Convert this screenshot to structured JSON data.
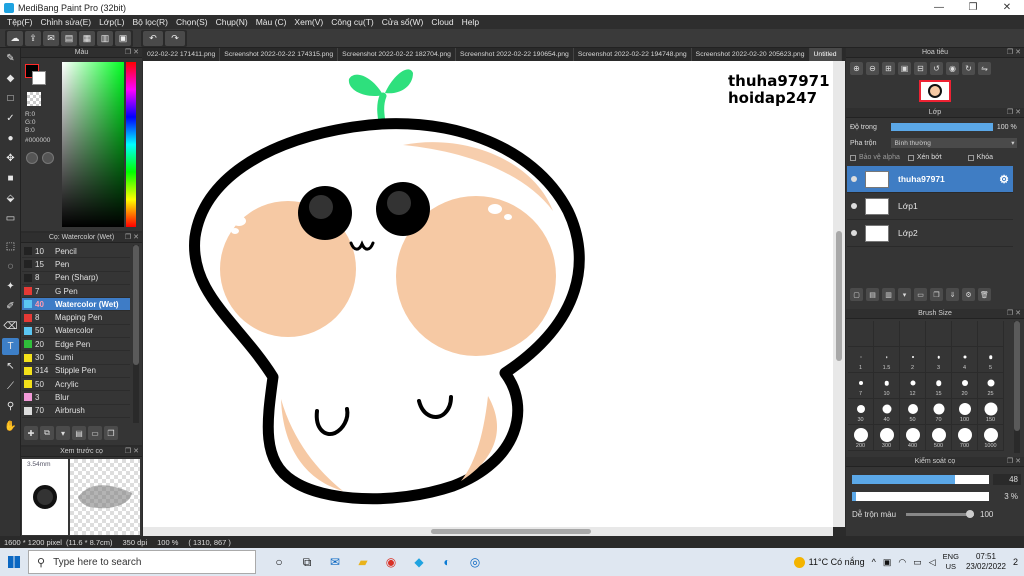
{
  "window": {
    "title": "MediBang Paint Pro (32bit)",
    "min": "—",
    "max": "❐",
    "close": "✕"
  },
  "menu": [
    "Tệp(F)",
    "Chỉnh sửa(E)",
    "Lớp(L)",
    "Bộ lọc(R)",
    "Chọn(S)",
    "Chụp(N)",
    "Màu (C)",
    "Xem(V)",
    "Công cụ(T)",
    "Cửa sổ(W)",
    "Cloud",
    "Help"
  ],
  "color_panel": {
    "title": "Màu",
    "r": "R:0",
    "g": "G:0",
    "b": "B:0",
    "hex": "#000000",
    "fg_color": "#000000",
    "bg_color": "#ffffff"
  },
  "brush_panel": {
    "title": "Cọ: Watercolor (Wet)",
    "brushes": [
      {
        "size": "10",
        "name": "Pencil",
        "color": "#222222"
      },
      {
        "size": "15",
        "name": "Pen",
        "color": "#222222"
      },
      {
        "size": "8",
        "name": "Pen (Sharp)",
        "color": "#222222"
      },
      {
        "size": "7",
        "name": "G Pen",
        "color": "#e53935"
      },
      {
        "size": "40",
        "name": "Watercolor (Wet)",
        "color": "#5bc6f2"
      },
      {
        "size": "8",
        "name": "Mapping Pen",
        "color": "#e53935"
      },
      {
        "size": "50",
        "name": "Watercolor",
        "color": "#5bc6f2"
      },
      {
        "size": "20",
        "name": "Edge Pen",
        "color": "#2fbf3a"
      },
      {
        "size": "30",
        "name": "Sumi",
        "color": "#f4e11a"
      },
      {
        "size": "314",
        "name": "Stipple Pen",
        "color": "#f4e11a"
      },
      {
        "size": "50",
        "name": "Acrylic",
        "color": "#f4e11a"
      },
      {
        "size": "3",
        "name": "Blur",
        "color": "#f29ad8"
      },
      {
        "size": "70",
        "name": "Airbrush",
        "color": "#dddddd"
      }
    ],
    "active_index": 4
  },
  "preview": {
    "title": "Xem trước cọ",
    "size": "3.54mm"
  },
  "doc_tabs": [
    "022-02-22 171411.png",
    "Screenshot 2022-02-22 174315.png",
    "Screenshot 2022-02-22 182704.png",
    "Screenshot 2022-02-22 190654.png",
    "Screenshot 2022-02-22 194748.png",
    "Screenshot 2022-02-20 205623.png",
    "Untitled"
  ],
  "canvas": {
    "watermark_line1": "thuha97971",
    "watermark_line2": "hoidap247"
  },
  "navigator": {
    "title": "Hoa tiêu"
  },
  "layers": {
    "title": "Lớp",
    "opacity_label": "Độ trong",
    "opacity_value": "100 %",
    "opacity_fraction": 1.0,
    "blend_label": "Pha trộn",
    "blend_value": "Bình thường",
    "protect_alpha": "Bảo vệ alpha",
    "clipping": "Xén bớt",
    "lock": "Khóa",
    "items": [
      {
        "name": "thuha97971",
        "active": true
      },
      {
        "name": "Lớp1",
        "active": false
      },
      {
        "name": "Lớp2",
        "active": false
      }
    ]
  },
  "brush_size": {
    "title": "Brush Size",
    "sizes": [
      "",
      "",
      "",
      "",
      "",
      "",
      "1",
      "1.5",
      "2",
      "3",
      "4",
      "5",
      "7",
      "10",
      "12",
      "15",
      "20",
      "25",
      "30",
      "40",
      "50",
      "70",
      "100",
      "150",
      "200",
      "300",
      "400",
      "500",
      "700",
      "1000"
    ]
  },
  "brush_control": {
    "title": "Kiểm soát cọ",
    "size_value": "48",
    "size_fraction": 0.75,
    "opacity_value": "3 %",
    "opacity_fraction": 0.03,
    "mix_label": "Dễ trộn màu",
    "mix_value": "100"
  },
  "status": {
    "size": "1600 * 1200 pixel",
    "cm": "(11.6 * 8.7cm)",
    "dpi": "350 dpi",
    "zoom": "100 %",
    "cursor": "( 1310, 867 )"
  },
  "taskbar": {
    "search_placeholder": "Type here to search",
    "weather": "11°C  Có nắng",
    "lang1": "ENG",
    "lang2": "US",
    "time": "07:51",
    "date": "23/02/2022",
    "notif": "2"
  }
}
